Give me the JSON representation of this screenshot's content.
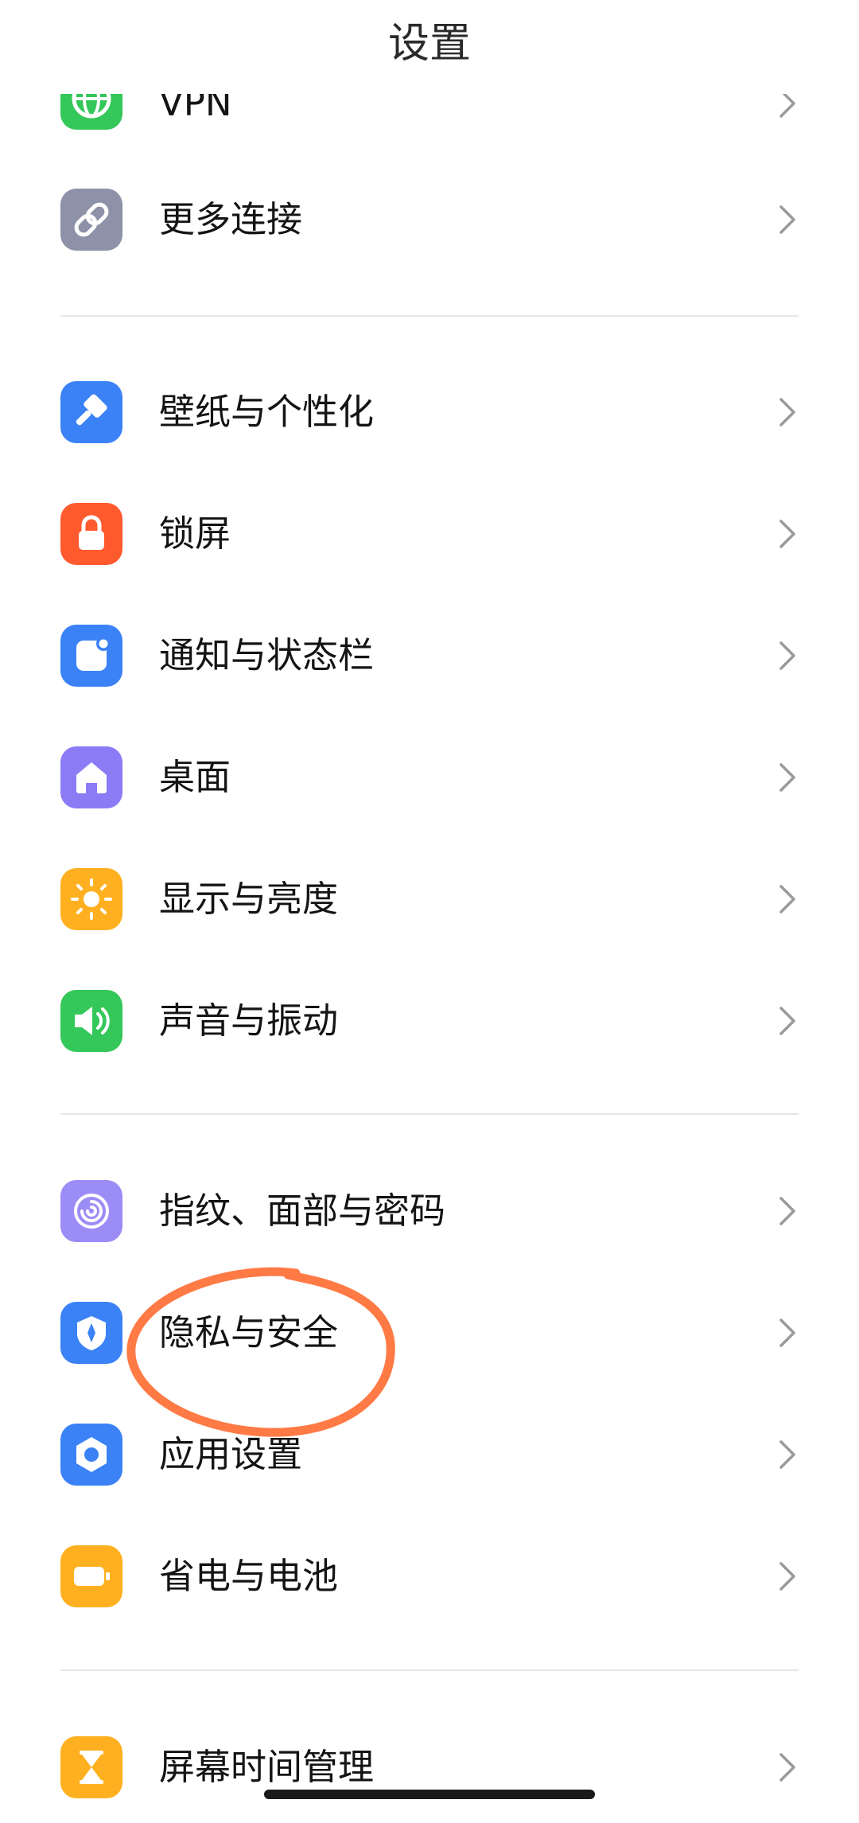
{
  "header": {
    "title": "设置"
  },
  "items": [
    {
      "label": "VPN",
      "icon": "globe-icon",
      "color": "#34C759"
    },
    {
      "label": "更多连接",
      "icon": "link-icon",
      "color": "#8E92A8"
    },
    {
      "label": "壁纸与个性化",
      "icon": "brush-icon",
      "color": "#3B82F6"
    },
    {
      "label": "锁屏",
      "icon": "lock-icon",
      "color": "#FF5A2E"
    },
    {
      "label": "通知与状态栏",
      "icon": "notification-icon",
      "color": "#3B82F6"
    },
    {
      "label": "桌面",
      "icon": "home-icon",
      "color": "#8B7CF6"
    },
    {
      "label": "显示与亮度",
      "icon": "sun-icon",
      "color": "#FFB020"
    },
    {
      "label": "声音与振动",
      "icon": "speaker-icon",
      "color": "#34C759"
    },
    {
      "label": "指纹、面部与密码",
      "icon": "fingerprint-icon",
      "color": "#9B8CF6"
    },
    {
      "label": "隐私与安全",
      "icon": "shield-icon",
      "color": "#3B82F6"
    },
    {
      "label": "应用设置",
      "icon": "app-hexagon-icon",
      "color": "#3B82F6"
    },
    {
      "label": "省电与电池",
      "icon": "battery-icon",
      "color": "#FFB020"
    },
    {
      "label": "屏幕时间管理",
      "icon": "hourglass-icon",
      "color": "#FFB020"
    }
  ],
  "annotation": {
    "color": "#FF7A45"
  }
}
